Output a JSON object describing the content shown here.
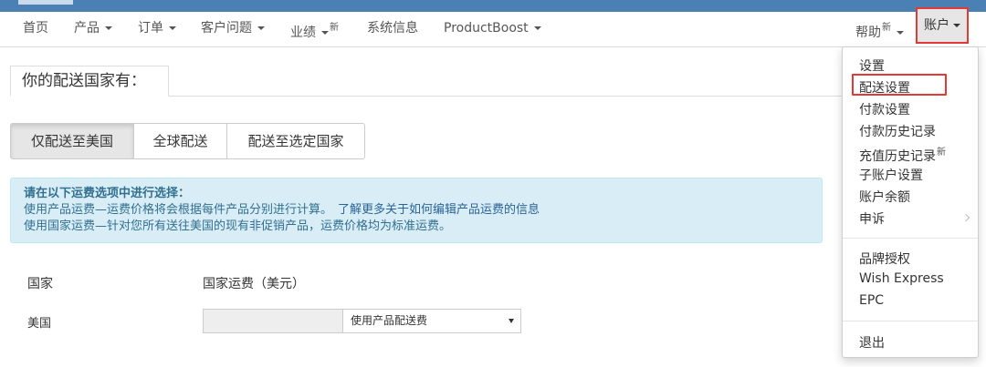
{
  "navbar": {
    "items": [
      {
        "label": "首页"
      },
      {
        "label": "产品"
      },
      {
        "label": "订单"
      },
      {
        "label": "客户问题"
      },
      {
        "label": "业绩",
        "badge": "新"
      },
      {
        "label": "系统信息"
      },
      {
        "label": "ProductBoost"
      }
    ],
    "help": {
      "label": "帮助",
      "badge": "新"
    },
    "account": {
      "label": "账户"
    }
  },
  "tab": {
    "label": "你的配送国家有："
  },
  "shipping_options": [
    {
      "label": "仅配送至美国",
      "active": true
    },
    {
      "label": "全球配送",
      "active": false
    },
    {
      "label": "配送至选定国家",
      "active": false
    }
  ],
  "info": {
    "title": "请在以下运费选项中进行选择：",
    "line1": "使用产品运费—运费价格将会根据每件产品分别进行计算。",
    "link": "了解更多关于如何编辑产品运费的信息",
    "line2": "使用国家运费—针对您所有送往美国的现有非促销产品，运费价格均为标准运费。"
  },
  "table": {
    "col_country": "国家",
    "col_shipping": "国家运费（美元）",
    "row_country": "美国",
    "input_value": "",
    "select_value": "使用产品配送费"
  },
  "account_menu": {
    "group1": [
      "设置",
      "配送设置",
      "付款设置",
      "付款历史记录",
      "充值历史记录",
      "子账户设置",
      "账户余额",
      "申诉"
    ],
    "recharge_badge": "新",
    "group2": [
      "品牌授权",
      "Wish Express",
      "EPC"
    ],
    "group3": [
      "退出"
    ]
  },
  "colors": {
    "top_bar": "#4a80b4",
    "highlight": "#e53935",
    "info_bg": "#d9edf7",
    "info_text": "#31708f"
  }
}
